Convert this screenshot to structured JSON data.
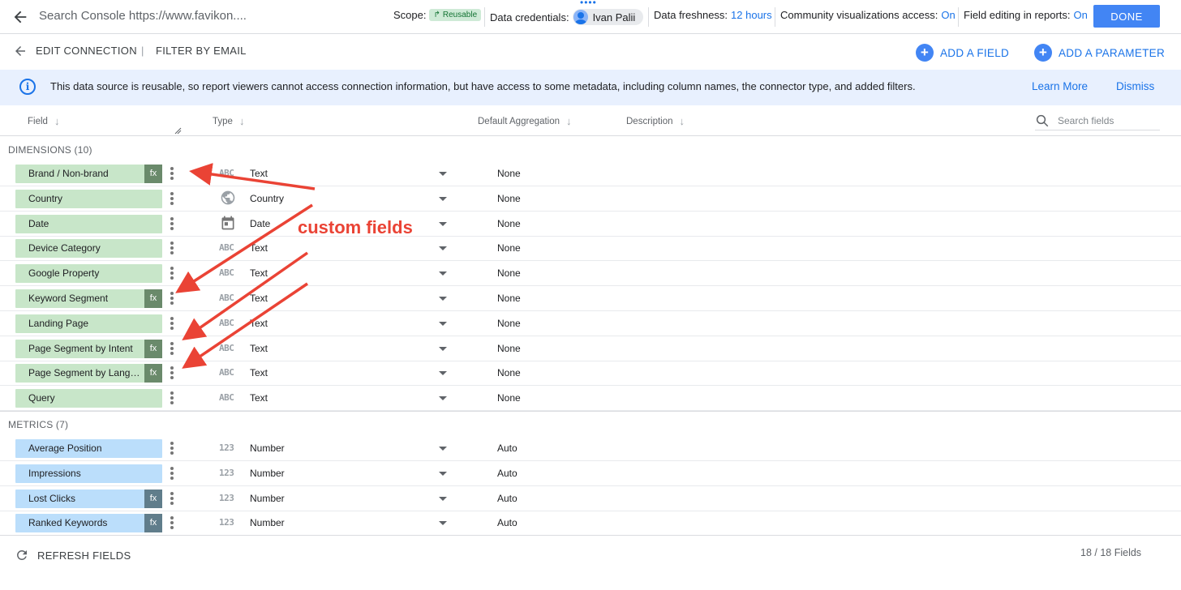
{
  "topbar": {
    "title": "Search Console https://www.favikon....",
    "scope_label": "Scope:",
    "scope_value": "Reusable",
    "credentials_label": "Data credentials:",
    "credentials_user": "Ivan Palii",
    "freshness_label": "Data freshness:",
    "freshness_value": "12 hours",
    "community_label": "Community visualizations access:",
    "community_value": "On",
    "field_editing_label": "Field editing in reports:",
    "field_editing_value": "On",
    "done_label": "DONE"
  },
  "subbar": {
    "edit_connection": "EDIT CONNECTION",
    "separator": "|",
    "filter_by_email": "FILTER BY EMAIL",
    "add_field": "ADD A FIELD",
    "add_parameter": "ADD A PARAMETER"
  },
  "banner": {
    "icon": "info-icon",
    "text": "This data source is reusable, so report viewers cannot access connection information, but have access to some metadata, including column names, the connector type, and added filters.",
    "learn_more": "Learn More",
    "dismiss": "Dismiss"
  },
  "columns": {
    "field": "Field",
    "type": "Type",
    "default_aggregation": "Default Aggregation",
    "description": "Description",
    "search_placeholder": "Search fields"
  },
  "dimensions": {
    "label": "DIMENSIONS (10)",
    "rows": [
      {
        "name": "Brand / Non-brand",
        "fx": true,
        "type_icon": "ABC",
        "type": "Text",
        "agg": "None"
      },
      {
        "name": "Country",
        "fx": false,
        "type_icon": "globe-icon",
        "type": "Country",
        "agg": "None"
      },
      {
        "name": "Date",
        "fx": false,
        "type_icon": "calendar-icon",
        "type": "Date",
        "agg": "None"
      },
      {
        "name": "Device Category",
        "fx": false,
        "type_icon": "ABC",
        "type": "Text",
        "agg": "None"
      },
      {
        "name": "Google Property",
        "fx": false,
        "type_icon": "ABC",
        "type": "Text",
        "agg": "None"
      },
      {
        "name": "Keyword Segment",
        "fx": true,
        "type_icon": "ABC",
        "type": "Text",
        "agg": "None"
      },
      {
        "name": "Landing Page",
        "fx": false,
        "type_icon": "ABC",
        "type": "Text",
        "agg": "None"
      },
      {
        "name": "Page Segment by Intent",
        "fx": true,
        "type_icon": "ABC",
        "type": "Text",
        "agg": "None"
      },
      {
        "name": "Page Segment by Language",
        "fx": true,
        "type_icon": "ABC",
        "type": "Text",
        "agg": "None"
      },
      {
        "name": "Query",
        "fx": false,
        "type_icon": "ABC",
        "type": "Text",
        "agg": "None"
      }
    ]
  },
  "metrics": {
    "label": "METRICS (7)",
    "rows": [
      {
        "name": "Average Position",
        "fx": false,
        "type_icon": "123",
        "type": "Number",
        "agg": "Auto"
      },
      {
        "name": "Impressions",
        "fx": false,
        "type_icon": "123",
        "type": "Number",
        "agg": "Auto"
      },
      {
        "name": "Lost Clicks",
        "fx": true,
        "type_icon": "123",
        "type": "Number",
        "agg": "Auto"
      },
      {
        "name": "Ranked Keywords",
        "fx": true,
        "type_icon": "123",
        "type": "Number",
        "agg": "Auto"
      }
    ]
  },
  "fx_label": "fx",
  "footer": {
    "refresh": "REFRESH FIELDS",
    "count": "18 / 18 Fields"
  },
  "annotation": {
    "text": "custom fields",
    "color": "#ea4335"
  },
  "colors": {
    "accent": "#1a73e8",
    "dimension": "#c8e6c9",
    "metric": "#bbdefb",
    "banner": "#e8f0fe"
  }
}
